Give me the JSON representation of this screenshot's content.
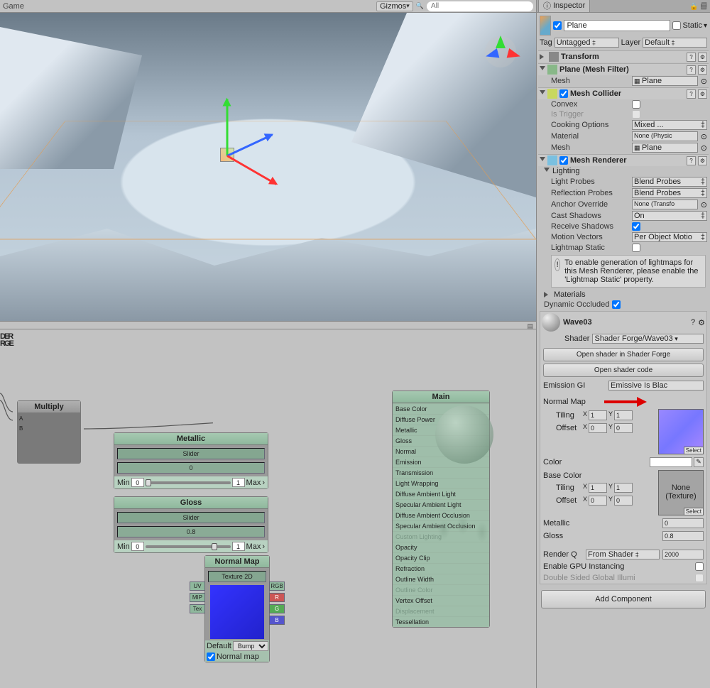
{
  "scene": {
    "tab": "Game",
    "gizmos": "Gizmos",
    "search_placeholder": "All",
    "search_value": ""
  },
  "inspector": {
    "tab": "Inspector",
    "object_name": "Plane",
    "active": true,
    "static_label": "Static",
    "static": false,
    "tag_label": "Tag",
    "tag_value": "Untagged",
    "layer_label": "Layer",
    "layer_value": "Default"
  },
  "components": {
    "transform": {
      "name": "Transform"
    },
    "mesh_filter": {
      "name": "Plane (Mesh Filter)",
      "mesh_label": "Mesh",
      "mesh_value": "Plane"
    },
    "mesh_collider": {
      "name": "Mesh Collider",
      "enabled": true,
      "convex_label": "Convex",
      "convex": false,
      "istrigger_label": "Is Trigger",
      "cooking_label": "Cooking Options",
      "cooking_value": "Mixed ...",
      "material_label": "Material",
      "material_value": "None (Physic",
      "mesh_label": "Mesh",
      "mesh_value": "Plane"
    },
    "mesh_renderer": {
      "name": "Mesh Renderer",
      "enabled": true,
      "lighting_label": "Lighting",
      "lightprobes_label": "Light Probes",
      "lightprobes_value": "Blend Probes",
      "reflprobes_label": "Reflection Probes",
      "reflprobes_value": "Blend Probes",
      "anchor_label": "Anchor Override",
      "anchor_value": "None (Transfo",
      "cast_label": "Cast Shadows",
      "cast_value": "On",
      "recv_label": "Receive Shadows",
      "recv": true,
      "motion_label": "Motion Vectors",
      "motion_value": "Per Object Motio",
      "lmstatic_label": "Lightmap Static",
      "lmstatic": false,
      "info": "To enable generation of lightmaps for this Mesh Renderer, please enable the 'Lightmap Static' property.",
      "materials_label": "Materials",
      "dynocc_label": "Dynamic Occluded",
      "dynocc": true
    }
  },
  "material": {
    "name": "Wave03",
    "shader_label": "Shader",
    "shader_value": "Shader Forge/Wave03",
    "open_sf": "Open shader in Shader Forge",
    "open_code": "Open shader code",
    "emission_label": "Emission GI",
    "emission_value": "Emissive Is Blac",
    "normalmap_label": "Normal Map",
    "tiling_label": "Tiling",
    "offset_label": "Offset",
    "nm_tiling_x": "1",
    "nm_tiling_y": "1",
    "nm_offset_x": "0",
    "nm_offset_y": "0",
    "select_label": "Select",
    "color_label": "Color",
    "basecolor_label": "Base Color",
    "none_texture": "None\n(Texture)",
    "bc_tiling_x": "1",
    "bc_tiling_y": "1",
    "bc_offset_x": "0",
    "bc_offset_y": "0",
    "metallic_label": "Metallic",
    "metallic_value": "0",
    "gloss_label": "Gloss",
    "gloss_value": "0.8",
    "renderq_label": "Render Q",
    "renderq_mode": "From Shader",
    "renderq_value": "2000",
    "gpu_label": "Enable GPU Instancing",
    "gpu": false,
    "dsgi_label": "Double Sided Global Illumi",
    "dsgi": false,
    "add_component": "Add Component"
  },
  "nodes": {
    "logo_top": "DER",
    "logo_bot": "RGE",
    "multiply": {
      "title": "Multiply",
      "a": "A",
      "b": "B"
    },
    "metallic": {
      "title": "Metallic",
      "type": "Slider",
      "value": "0",
      "min_label": "Min",
      "min": "0",
      "max_label": "Max",
      "max": "1"
    },
    "gloss": {
      "title": "Gloss",
      "type": "Slider",
      "value": "0.8",
      "min_label": "Min",
      "min": "0",
      "max_label": "Max",
      "max": "1"
    },
    "normal": {
      "title": "Normal Map",
      "type": "Texture 2D",
      "uv": "UV",
      "mip": "MIP",
      "tex": "Tex",
      "rgb": "RGB",
      "r": "R",
      "g": "G",
      "b": "B",
      "default_label": "Default",
      "default_value": "Bump",
      "nm_label": "Normal map",
      "nm_checked": true
    },
    "main": {
      "title": "Main",
      "items": [
        "Base Color",
        "Diffuse Power",
        "Metallic",
        "Gloss",
        "Normal",
        "Emission",
        "Transmission",
        "Light Wrapping",
        "Diffuse Ambient Light",
        "Specular Ambient Light",
        "Diffuse Ambient Occlusion",
        "Specular Ambient Occlusion",
        "Custom Lighting",
        "Opacity",
        "Opacity Clip",
        "Refraction",
        "Outline Width",
        "Outline Color",
        "Vertex Offset",
        "Displacement",
        "Tessellation"
      ]
    }
  }
}
